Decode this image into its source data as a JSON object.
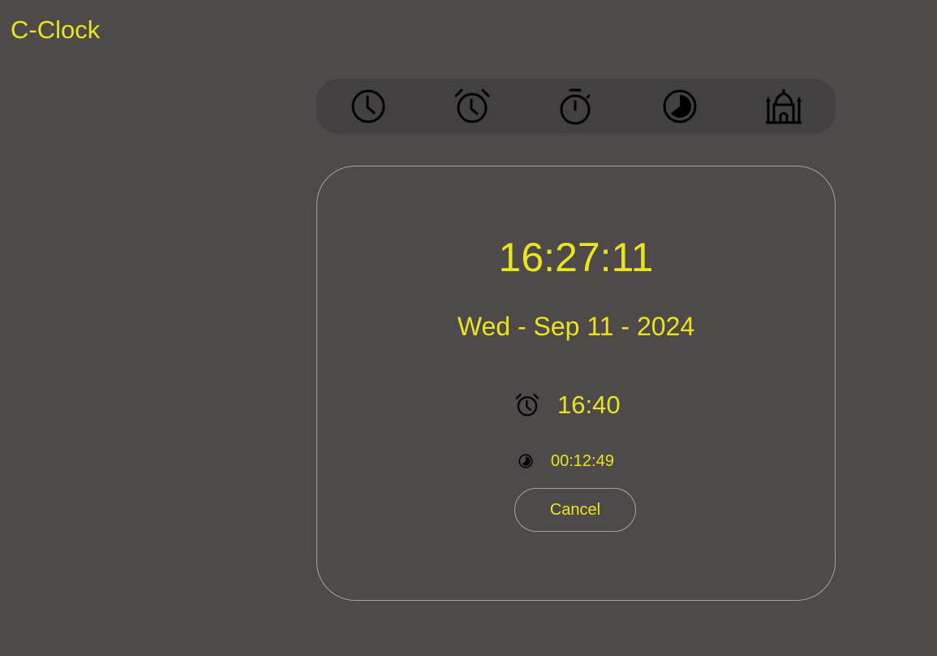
{
  "app": {
    "title": "C-Clock"
  },
  "nav": {
    "items": [
      {
        "icon": "clock-icon"
      },
      {
        "icon": "alarm-icon"
      },
      {
        "icon": "stopwatch-icon"
      },
      {
        "icon": "timer-icon"
      },
      {
        "icon": "mosque-icon"
      }
    ]
  },
  "clock": {
    "time": "16:27:11",
    "date": "Wed - Sep 11 - 2024"
  },
  "alarm": {
    "icon": "alarm-icon",
    "time": "16:40"
  },
  "timer": {
    "icon": "timer-icon",
    "remaining": "00:12:49"
  },
  "actions": {
    "cancel_label": "Cancel"
  },
  "colors": {
    "background": "#4f4a4a",
    "nav_background": "#424040",
    "accent": "#e8e41e",
    "border": "#a8a3a3",
    "icon": "#000000"
  }
}
